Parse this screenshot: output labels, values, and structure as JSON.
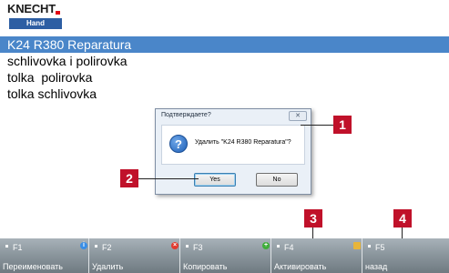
{
  "logo": {
    "brand": "KNECHT",
    "sub": "Hand"
  },
  "list": {
    "items": [
      {
        "label": "K24 R380 Reparatura",
        "selected": true
      },
      {
        "label": "schlivovka i polirovka",
        "selected": false
      },
      {
        "label": "tolka  polirovka",
        "selected": false
      },
      {
        "label": "tolka schlivovka",
        "selected": false
      }
    ]
  },
  "dialog": {
    "title": "Подтверждаете?",
    "close": "✕",
    "icon": "question-icon",
    "message": "Удалить \"K24 R380 Reparatura\"?",
    "yes_label": "Yes",
    "no_label": "No"
  },
  "callouts": [
    "1",
    "2",
    "3",
    "4"
  ],
  "fkeys": [
    {
      "key": "F1",
      "action": "Переименовать",
      "icon": "",
      "icon_color": ""
    },
    {
      "key": "F2",
      "action": "Удалить",
      "icon": "info-icon",
      "icon_color": "#3a8ee6"
    },
    {
      "key": "F3",
      "action": "Копировать",
      "icon": "delete-icon",
      "icon_color": "#e23a2e"
    },
    {
      "key": "F4",
      "action": "Активировать",
      "icon": "add-icon",
      "icon_color": "#3fae3a"
    },
    {
      "key": "F5",
      "action": "назад",
      "icon": "folder-icon",
      "icon_color": "#e8b53a"
    }
  ],
  "colors": {
    "selection": "#4a86c9",
    "callout": "#c0112a",
    "brand_blue": "#2d5ea3",
    "brand_red": "#e30613"
  }
}
